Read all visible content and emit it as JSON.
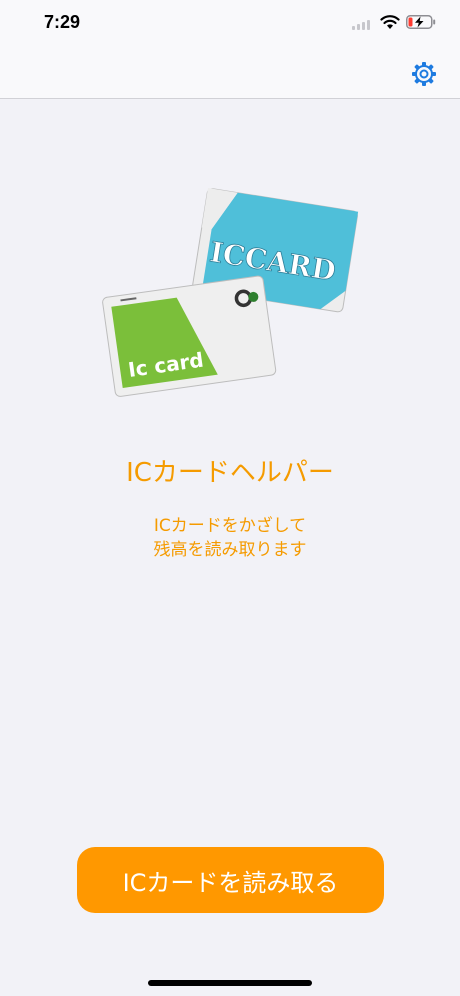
{
  "status_bar": {
    "time": "7:29"
  },
  "nav": {
    "settings_icon": "gear-icon"
  },
  "illustration": {
    "back_card_text": "ICCARD",
    "front_card_text": "Ic card",
    "colors": {
      "back_card": "#4FBFD9",
      "front_card": "#7BBF3A"
    }
  },
  "main": {
    "title": "ICカードヘルパー",
    "instruction_line1": "ICカードをかざして",
    "instruction_line2": "残高を読み取ります"
  },
  "action": {
    "read_button_label": "ICカードを読み取る"
  },
  "colors": {
    "accent": "#FF9800",
    "text_accent": "#F59B00",
    "background": "#F2F2F7",
    "nav_icon": "#1E7BE0"
  }
}
